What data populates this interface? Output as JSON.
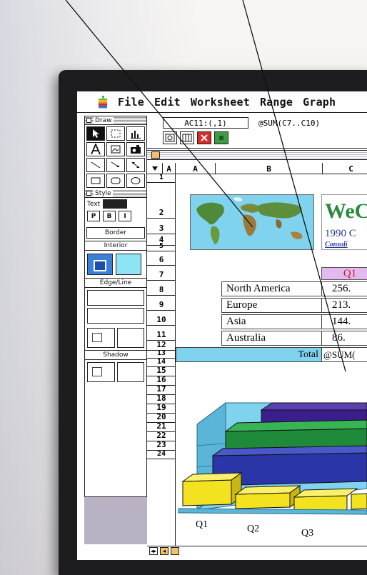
{
  "menubar": {
    "items": [
      "File",
      "Edit",
      "Worksheet",
      "Range",
      "Graph"
    ]
  },
  "palette": {
    "draw_title": "Draw",
    "style_title": "Style",
    "text_label": "Text",
    "pbuttons": [
      "P",
      "B",
      "I"
    ],
    "border_label": "Border",
    "interior_label": "Interior",
    "edge_label": "Edge/Line",
    "shadow_label": "Shadow"
  },
  "toolbar": {
    "cell_reference": "AC11:(,1)",
    "formula": "@SUM(C7..C10)"
  },
  "columns": {
    "corner": "A",
    "labels": [
      "A",
      "B",
      "C"
    ]
  },
  "rows": [
    "1",
    "2",
    "3",
    "4",
    "5",
    "6",
    "7",
    "8",
    "9",
    "10",
    "11",
    "12",
    "13",
    "14",
    "15",
    "16",
    "17",
    "18",
    "19",
    "20",
    "21",
    "22",
    "23",
    "24"
  ],
  "sheet": {
    "title_big": "WeC",
    "title_sub": "1990 C",
    "title_cons": "Consoli",
    "q1_header": "Q1",
    "regions": [
      {
        "name": "North America",
        "value": "256."
      },
      {
        "name": "Europe",
        "value": "213."
      },
      {
        "name": "Asia",
        "value": "144."
      },
      {
        "name": "Australia",
        "value": "86."
      }
    ],
    "total_label": "Total",
    "total_formula": "@SUM("
  },
  "chart": {
    "categories": [
      "Q1",
      "Q2",
      "Q3"
    ],
    "colors": {
      "yellow": "#f2e21f",
      "blue": "#2a36a8",
      "green": "#1f8a3a",
      "purple": "#3a1f8c",
      "cyan": "#7fd3ee"
    }
  }
}
